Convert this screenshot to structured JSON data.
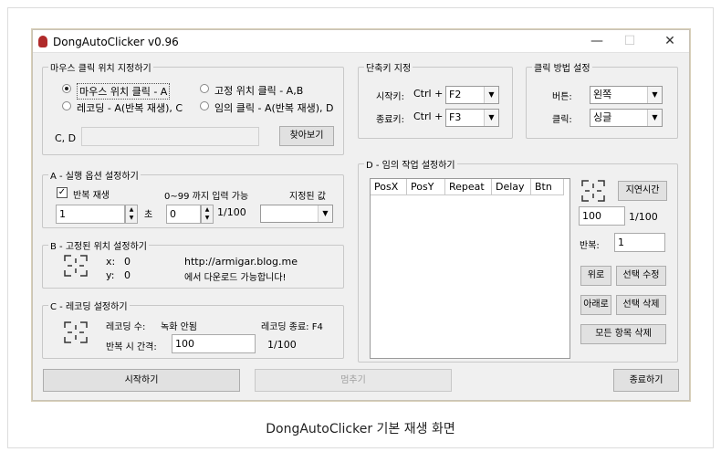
{
  "window": {
    "title": "DongAutoClicker v0.96",
    "minimize": "—",
    "maximize": "☐",
    "close": "✕"
  },
  "mouse_pos": {
    "legend": "마우스 클릭 위치 지정하기",
    "opt_mouse": "마우스 위치 클릭 - A",
    "opt_fixed": "고정 위치 클릭 - A,B",
    "opt_record": "레코딩 - A(반복 재생), C",
    "opt_any": "임의 클릭 - A(반복 재생), D",
    "cd_label": "C, D",
    "cd_value": "",
    "browse_label": "찾아보기"
  },
  "hotkey": {
    "legend": "단축키 지정",
    "start_label": "시작키:",
    "start_mod": "Ctrl +",
    "start_key": "F2",
    "end_label": "종료키:",
    "end_mod": "Ctrl +",
    "end_key": "F3"
  },
  "click_method": {
    "legend": "클릭 방법 설정",
    "button_label": "버튼:",
    "button_value": "왼쪽",
    "click_label": "클릭:",
    "click_value": "싱글"
  },
  "section_a": {
    "legend": "A - 실행 옵션 설정하기",
    "repeat_label": "반복 재생",
    "hint": "0~99 까지 입력 가능",
    "selected_label": "지정된 값",
    "repeat_value": "1",
    "unit": "초",
    "centi_value": "0",
    "centi_unit": "1/100",
    "selected_value": ""
  },
  "section_b": {
    "legend": "B - 고정된 위치 설정하기",
    "x_label": "x:",
    "x_value": "0",
    "y_label": "y:",
    "y_value": "0",
    "url": "http://armigar.blog.me",
    "download_note": "에서 다운로드 가능합니다!"
  },
  "section_c": {
    "legend": "C - 레코딩 설정하기",
    "count_label": "레코딩 수:",
    "count_value": "녹화 안됨",
    "end_label": "레코딩 종료: F4",
    "interval_label": "반복 시 간격:",
    "interval_value": "100",
    "interval_unit": "1/100"
  },
  "section_d": {
    "legend": "D - 임의 작업 설정하기",
    "columns": [
      "PosX",
      "PosY",
      "Repeat",
      "Delay",
      "Btn"
    ],
    "delay_button": "지연시간",
    "delay_value": "100",
    "delay_unit": "1/100",
    "repeat_label": "반복:",
    "repeat_value": "1",
    "up_button": "위로",
    "edit_button": "선택 수정",
    "down_button": "아래로",
    "delete_button": "선택 삭제",
    "delete_all_button": "모든 항목 삭제"
  },
  "bottom": {
    "start": "시작하기",
    "stop": "멈추기",
    "exit": "종료하기"
  },
  "caption": "DongAutoClicker 기본 재생 화면"
}
